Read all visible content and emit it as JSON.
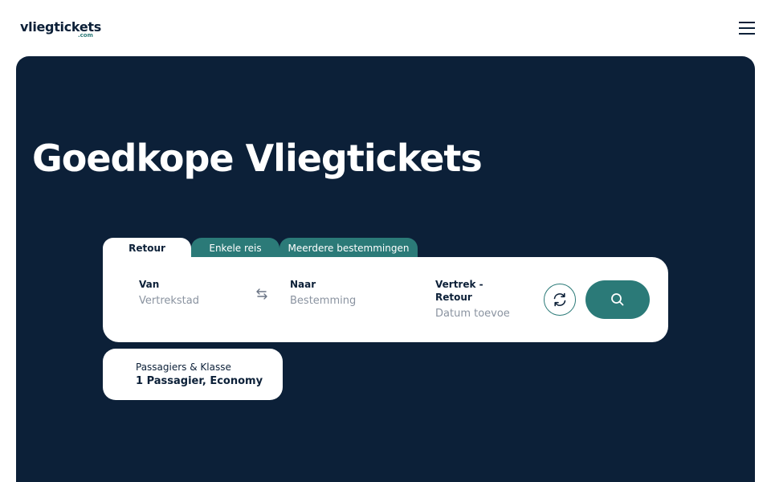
{
  "header": {
    "logo_main": "vliegtickets",
    "logo_sub": ".com",
    "menu_icon": "hamburger-menu-icon"
  },
  "hero": {
    "title": "Goedkope Vliegtickets"
  },
  "tabs": [
    {
      "label": "Retour",
      "active": true
    },
    {
      "label": "Enkele reis",
      "active": false
    },
    {
      "label": "Meerdere bestemmingen",
      "active": false
    }
  ],
  "search": {
    "from": {
      "label": "Van",
      "placeholder": "Vertrekstad"
    },
    "swap_icon": "swap-arrows-icon",
    "to": {
      "label": "Naar",
      "placeholder": "Bestemming"
    },
    "dates": {
      "label_line1": "Vertrek -",
      "label_line2": "Retour",
      "placeholder": "Datum toevoe"
    },
    "refresh_icon": "refresh-icon",
    "search_icon": "search-icon"
  },
  "passengers": {
    "label": "Passagiers & Klasse",
    "value": "1 Passagier, Economy"
  },
  "colors": {
    "navy": "#0c2038",
    "teal": "#2b7a78",
    "white": "#ffffff",
    "placeholder": "#8a93a0"
  }
}
